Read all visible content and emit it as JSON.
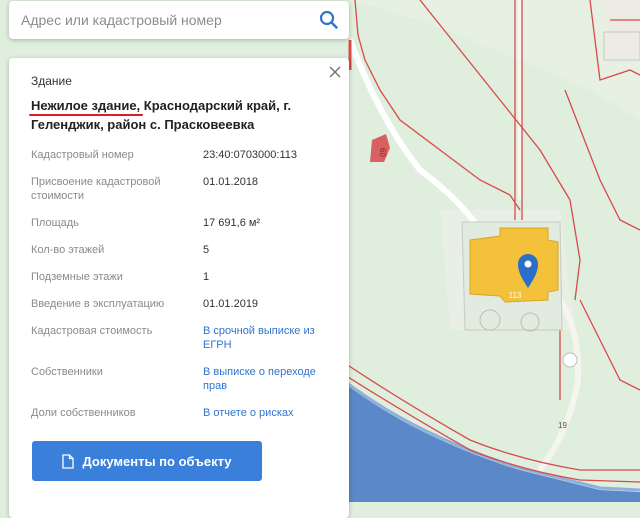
{
  "search": {
    "placeholder": "Адрес или кадастровый номер"
  },
  "card": {
    "type": "Здание",
    "title_part1": "Нежилое здание,",
    "title_part2": " Краснодарский край, г. Геленджик, район с. Прасковеевка",
    "rows": [
      {
        "label": "Кадастровый номер",
        "value": "23:40:0703000:113"
      },
      {
        "label": "Присвоение кадастровой стоимости",
        "value": "01.01.2018"
      },
      {
        "label": "Площадь",
        "value": "17 691,6 м²"
      },
      {
        "label": "Кол-во этажей",
        "value": "5"
      },
      {
        "label": "Подземные этажи",
        "value": "1"
      },
      {
        "label": "Введение в эксплуатацию",
        "value": "01.01.2019"
      },
      {
        "label": "Кадастровая стоимость",
        "value": "В срочной выписке из ЕГРН"
      },
      {
        "label": "Собственники",
        "value": "В выписке о переходе прав"
      },
      {
        "label": "Доли собственников",
        "value": "В отчете о рисках"
      }
    ],
    "documents_button": "Документы по объекту"
  },
  "map": {
    "labels": {
      "building": "113",
      "small_building": "60",
      "road": "19"
    },
    "colors": {
      "background": "#dfeedd",
      "building": "#f3c23a",
      "marker": "#2b6fc9",
      "boundary": "#d94a4a",
      "water": "#5b88c8"
    },
    "icons": [
      "search-icon",
      "close-icon",
      "document-icon",
      "map-marker-icon"
    ]
  }
}
